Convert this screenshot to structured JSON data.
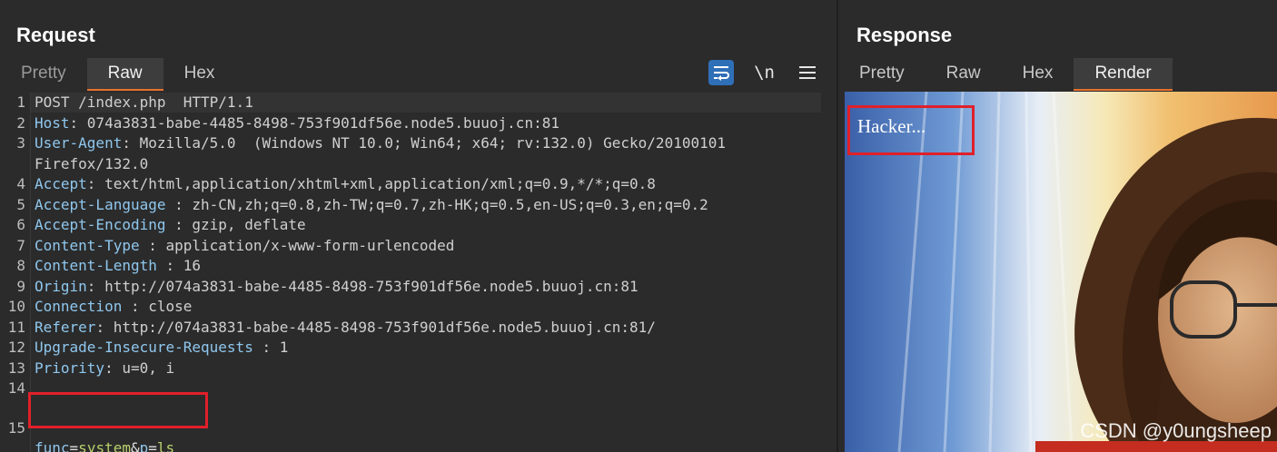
{
  "request": {
    "title": "Request",
    "tabs": [
      "Pretty",
      "Raw",
      "Hex"
    ],
    "active_tab": "Raw",
    "tools": {
      "wrap_icon": "wrap-lines-icon",
      "newline_label": "\\n",
      "menu_icon": "hamburger-menu-icon"
    },
    "lines": [
      {
        "n": "1",
        "k": "POST /index.php  HTTP/1.1",
        "v": ""
      },
      {
        "n": "2",
        "k": "Host",
        "v": ": 074a3831-babe-4485-8498-753f901df56e.node5.buuoj.cn:81"
      },
      {
        "n": "3",
        "k": "User-Agent",
        "v": ": Mozilla/5.0  (Windows NT 10.0; Win64; x64; rv:132.0) Gecko/20100101"
      },
      {
        "n": "",
        "k": "",
        "v": "Firefox/132.0"
      },
      {
        "n": "4",
        "k": "Accept",
        "v": ": text/html,application/xhtml+xml,application/xml;q=0.9,*/*;q=0.8"
      },
      {
        "n": "5",
        "k": "Accept-Language",
        "v": " : zh-CN,zh;q=0.8,zh-TW;q=0.7,zh-HK;q=0.5,en-US;q=0.3,en;q=0.2"
      },
      {
        "n": "6",
        "k": "Accept-Encoding",
        "v": " : gzip, deflate"
      },
      {
        "n": "7",
        "k": "Content-Type",
        "v": " : application/x-www-form-urlencoded"
      },
      {
        "n": "8",
        "k": "Content-Length",
        "v": " : 16"
      },
      {
        "n": "9",
        "k": "Origin",
        "v": ": http://074a3831-babe-4485-8498-753f901df56e.node5.buuoj.cn:81"
      },
      {
        "n": "10",
        "k": "Connection",
        "v": " : close"
      },
      {
        "n": "11",
        "k": "Referer",
        "v": ": http://074a3831-babe-4485-8498-753f901df56e.node5.buuoj.cn:81/"
      },
      {
        "n": "12",
        "k": "Upgrade-Insecure-Requests",
        "v": " : 1"
      },
      {
        "n": "13",
        "k": "Priority",
        "v": ": u=0, i"
      },
      {
        "n": "14",
        "k": "",
        "v": ""
      }
    ],
    "body_line": {
      "n": "15",
      "p1_key": "func",
      "p1_eq": "=",
      "p1_val": "system",
      "amp": "&",
      "p2_key": "p",
      "p2_eq": "=",
      "p2_val": "ls"
    }
  },
  "response": {
    "title": "Response",
    "tabs": [
      "Pretty",
      "Raw",
      "Hex",
      "Render"
    ],
    "active_tab": "Render",
    "render_text": "Hacker...",
    "watermark": "CSDN @y0ungsheep"
  },
  "colors": {
    "accent": "#e8712d",
    "highlight_box": "#e0202a",
    "header_key": "#8fc7ee",
    "param_value": "#b8d06b"
  }
}
